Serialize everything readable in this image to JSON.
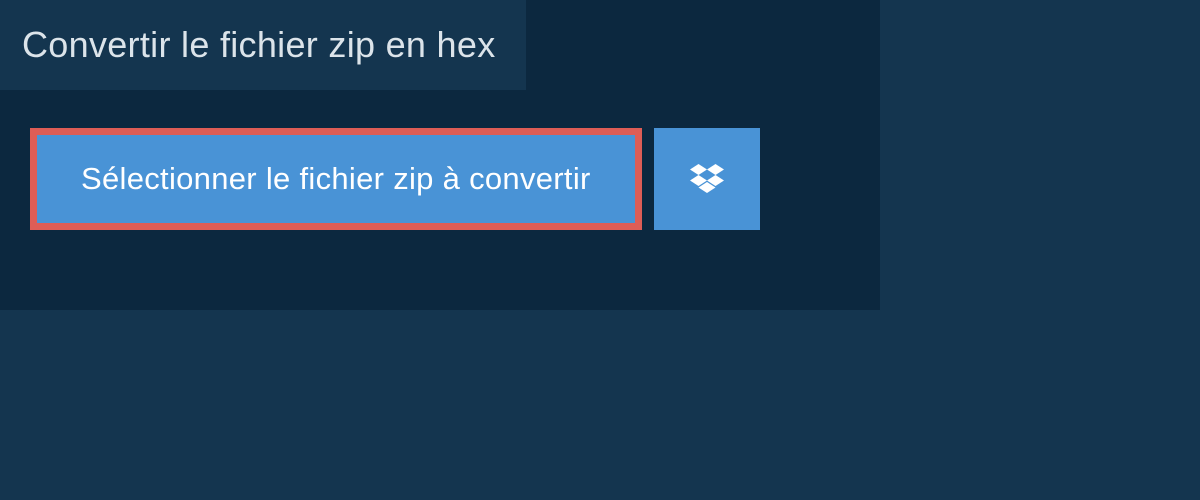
{
  "header": {
    "title": "Convertir le fichier zip en hex"
  },
  "actions": {
    "select_file_label": "Sélectionner le fichier zip à convertir"
  },
  "colors": {
    "background_outer": "#14354f",
    "background_inner": "#0c283f",
    "button_primary": "#4993d6",
    "button_highlight_border": "#de5d56",
    "text_light": "#dce4ea"
  }
}
